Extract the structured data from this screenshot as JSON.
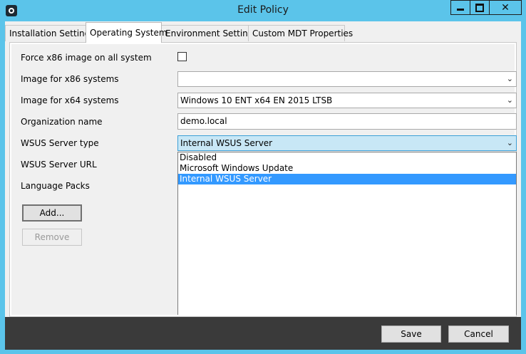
{
  "window": {
    "title": "Edit Policy"
  },
  "tabs": [
    {
      "label": "Installation Settings",
      "active": false
    },
    {
      "label": "Operating System",
      "active": true
    },
    {
      "label": "Environment Settings",
      "active": false
    },
    {
      "label": "Custom MDT Properties",
      "active": false
    }
  ],
  "form": {
    "force_x86_label": "Force x86 image on all system",
    "force_x86_checked": false,
    "image_x86_label": "Image for x86 systems",
    "image_x86_value": "",
    "image_x64_label": "Image for x64 systems",
    "image_x64_value": "Windows 10 ENT x64 EN 2015 LTSB",
    "org_label": "Organization name",
    "org_value": "demo.local",
    "wsus_type_label": "WSUS Server type",
    "wsus_type_value": "Internal WSUS Server",
    "wsus_type_options": [
      "Disabled",
      "Microsoft Windows Update",
      "Internal WSUS Server"
    ],
    "wsus_type_selected_index": 2,
    "wsus_url_label": "WSUS Server URL",
    "language_packs_label": "Language Packs",
    "add_label": "Add...",
    "remove_label": "Remove"
  },
  "footer": {
    "save_label": "Save",
    "cancel_label": "Cancel"
  },
  "icons": {
    "app": "app-icon",
    "minimize": "minimize-icon",
    "maximize": "maximize-icon",
    "close": "close-icon",
    "dropdown": "chevron-down-icon"
  },
  "colors": {
    "titlebar": "#5bc4ea",
    "selection": "#3399ff",
    "footer": "#3a3a3a"
  }
}
